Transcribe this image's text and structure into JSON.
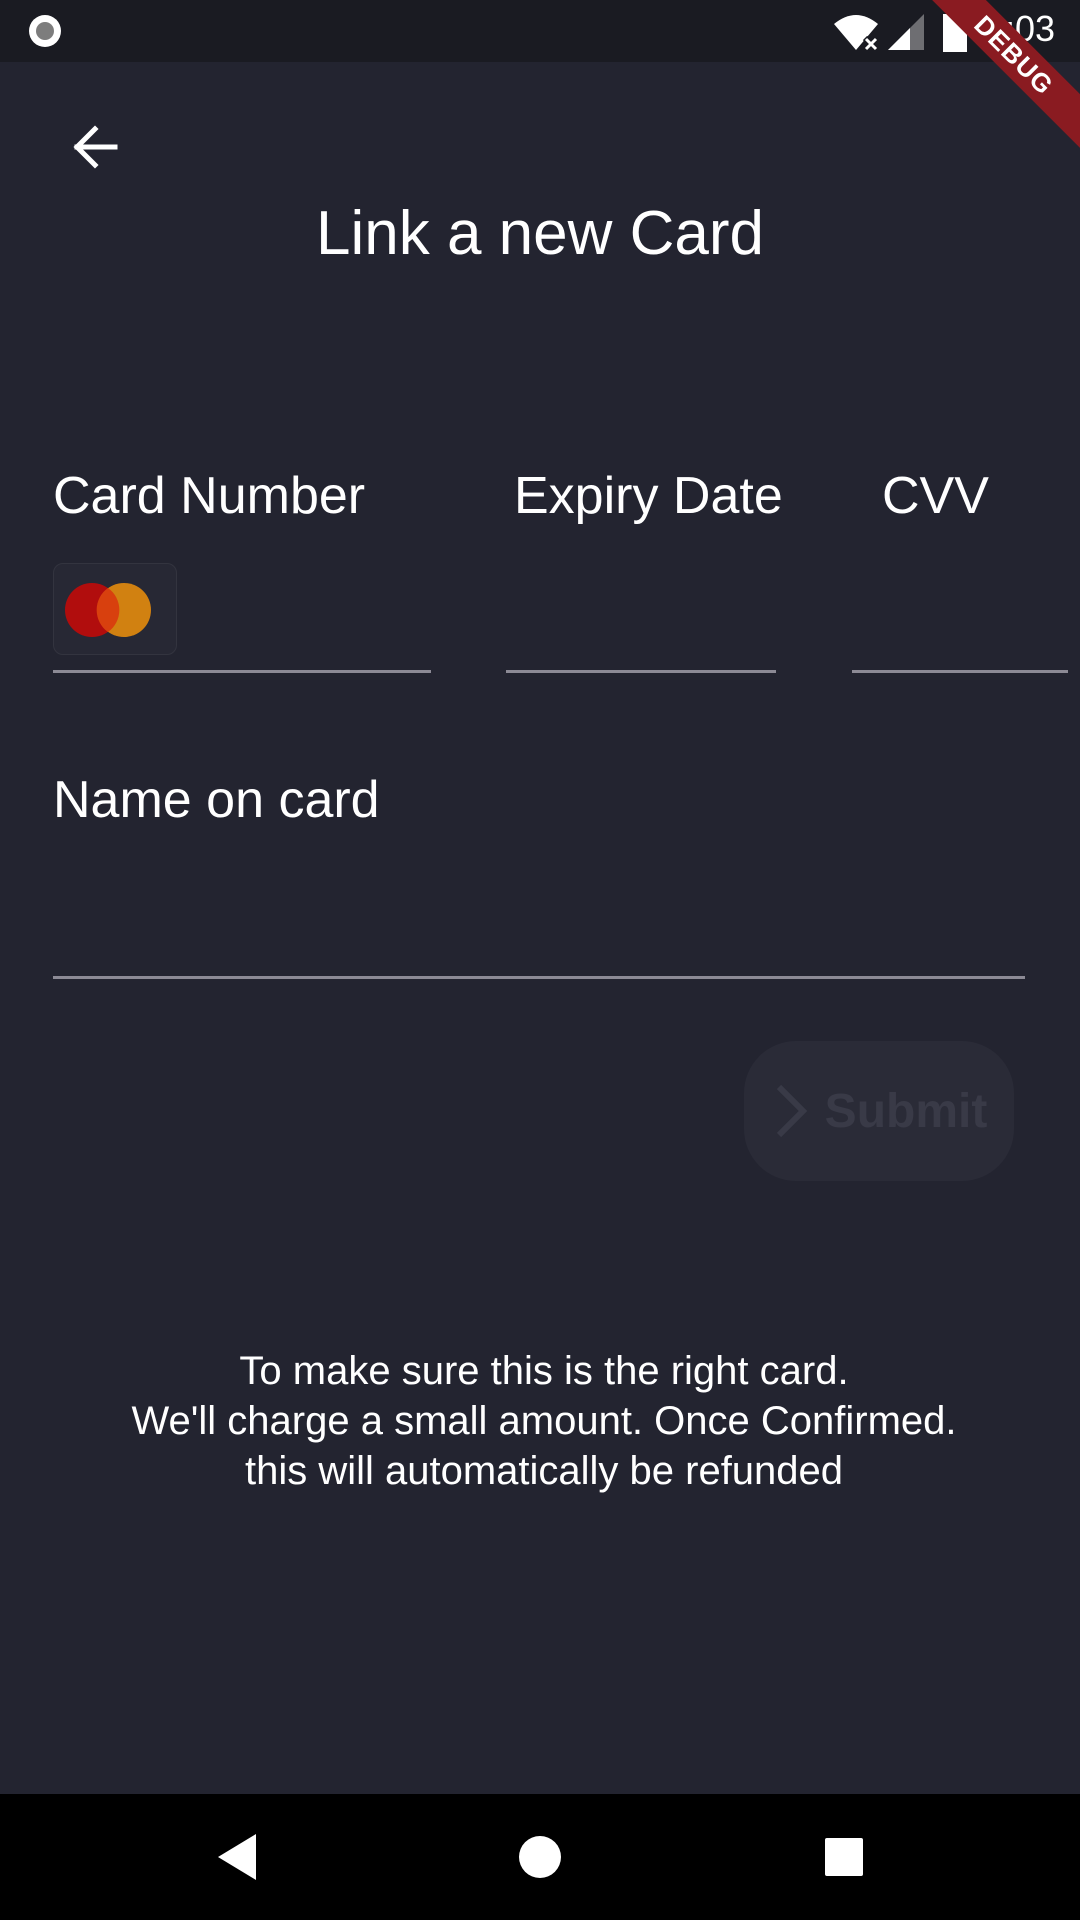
{
  "status_bar": {
    "time": "6:03",
    "debug_label": "DEBUG",
    "icons": [
      "record-icon",
      "wifi-icon",
      "signal-icon",
      "battery-icon"
    ]
  },
  "header": {
    "back_icon": "arrow-left-icon",
    "title": "Link a new Card"
  },
  "form": {
    "card_number": {
      "label": "Card Number",
      "value": "",
      "brand_icon": "mastercard-icon"
    },
    "expiry_date": {
      "label": "Expiry Date",
      "value": ""
    },
    "cvv": {
      "label": "CVV",
      "value": ""
    },
    "name_on_card": {
      "label": "Name on card",
      "value": ""
    },
    "submit_label": "Submit"
  },
  "info": {
    "line1": "To make sure this is the right card.",
    "line2": "We'll charge a small amount. Once Confirmed.",
    "line3": "this will automatically be refunded"
  },
  "nav_bar": {
    "icons": [
      "nav-back-icon",
      "nav-home-icon",
      "nav-recents-icon"
    ]
  },
  "colors": {
    "background": "#232430",
    "mastercard_red": "#b10d0d",
    "mastercard_orange": "#e0890e",
    "debug_ribbon": "#8a1b21"
  }
}
